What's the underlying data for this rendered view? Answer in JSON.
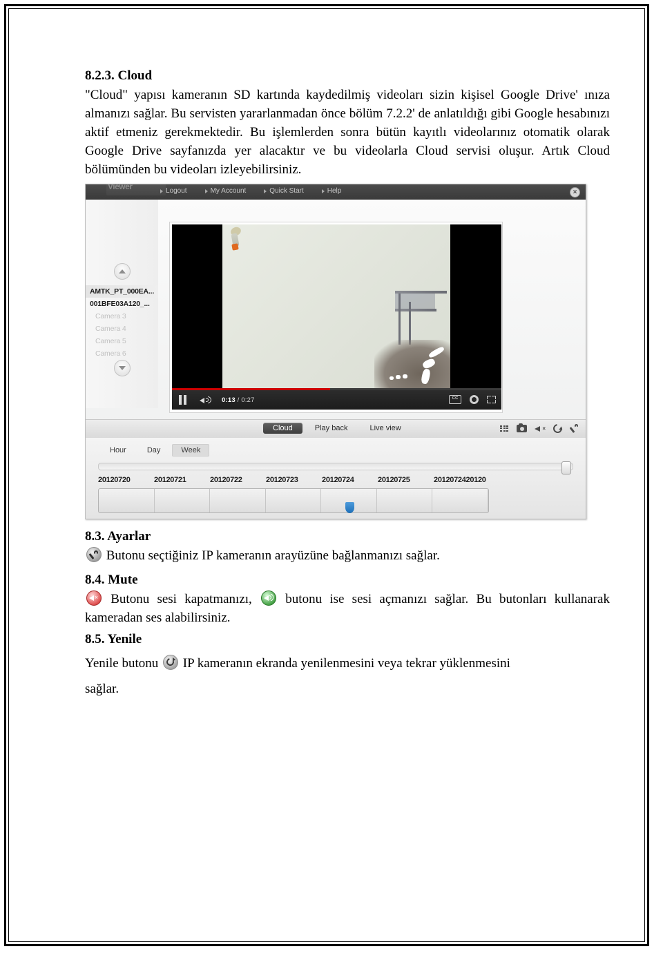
{
  "document": {
    "sections": [
      {
        "id": "8-2-3",
        "heading": "8.2.3. Cloud",
        "paragraph": "\"Cloud\" yapısı kameranın SD kartında kaydedilmiş videoları sizin kişisel Google Drive' ınıza almanızı sağlar. Bu servisten yararlanmadan önce bölüm 7.2.2' de anlatıldığı gibi Google hesabınızı aktif etmeniz gerekmektedir. Bu işlemlerden sonra bütün kayıtlı videolarınız otomatik olarak Google Drive sayfanızda yer alacaktır ve bu videolarla Cloud servisi oluşur. Artık Cloud bölümünden bu videoları izleyebilirsiniz."
      },
      {
        "id": "8-3",
        "heading": "8.3. Ayarlar",
        "icon": "settings-wrench-icon",
        "paragraph": "Butonu seçtiğiniz IP kameranın arayüzüne bağlanmanızı sağlar."
      },
      {
        "id": "8-4",
        "heading": "8.4. Mute",
        "icon_mute": "mute-icon",
        "icon_sound": "sound-on-icon",
        "part1": "Butonu sesi kapatmanızı,",
        "part2": "butonu ise sesi açmanızı sağlar. Bu butonları kullanarak kameradan ses alabilirsiniz."
      },
      {
        "id": "8-5",
        "heading": "8.5. Yenile",
        "icon": "refresh-icon",
        "part1": "Yenile butonu",
        "part2": "IP kameranın ekranda yenilenmesini veya tekrar yüklenmesini",
        "part3": "sağlar."
      }
    ]
  },
  "screenshot": {
    "logo_text": "Viewer",
    "close_icon": "close-icon",
    "nav": [
      {
        "label": "Logout"
      },
      {
        "label": "My Account"
      },
      {
        "label": "Quick Start"
      },
      {
        "label": "Help"
      }
    ],
    "camera_list": {
      "scroll_up_icon": "chevron-up-icon",
      "scroll_down_icon": "chevron-down-icon",
      "items": [
        {
          "label": "AMTK_PT_000EA...",
          "state": "selected"
        },
        {
          "label": "001BFE03A120_...",
          "state": "active"
        },
        {
          "label": "Camera 3",
          "state": "disabled"
        },
        {
          "label": "Camera 4",
          "state": "disabled"
        },
        {
          "label": "Camera 5",
          "state": "disabled"
        },
        {
          "label": "Camera 6",
          "state": "disabled"
        }
      ]
    },
    "player": {
      "pause_icon": "pause-icon",
      "volume_icon": "volume-icon",
      "current_time": "0:13",
      "time_separator": " / ",
      "total_time": "0:27",
      "progress_percent": 48,
      "cc_label": "CC",
      "cc_icon": "closed-caption-icon",
      "settings_icon": "gear-icon",
      "fullscreen_icon": "fullscreen-icon"
    },
    "tabs": [
      {
        "label": "Cloud",
        "active": true
      },
      {
        "label": "Play back",
        "active": false
      },
      {
        "label": "Live view",
        "active": false
      }
    ],
    "toolbar_icons": [
      {
        "name": "grid-layout-icon"
      },
      {
        "name": "snapshot-camera-icon"
      },
      {
        "name": "mute-speaker-icon"
      },
      {
        "name": "refresh-icon"
      },
      {
        "name": "settings-wrench-icon"
      }
    ],
    "timeline": {
      "range_tabs": [
        {
          "label": "Hour",
          "active": false
        },
        {
          "label": "Day",
          "active": false
        },
        {
          "label": "Week",
          "active": true
        }
      ],
      "slider_handle_icon": "slider-handle",
      "dates": [
        "20120720",
        "20120721",
        "20120722",
        "20120723",
        "20120724",
        "20120725",
        "2012072420120"
      ],
      "marker_index": 4,
      "marker_icon": "timeline-marker"
    }
  },
  "colors": {
    "accent_red": "#cc0000",
    "accent_blue": "#1d6fb8",
    "mute_red": "#e05252",
    "sound_green": "#49a349",
    "tab_active_bg": "#3f3f3f"
  }
}
